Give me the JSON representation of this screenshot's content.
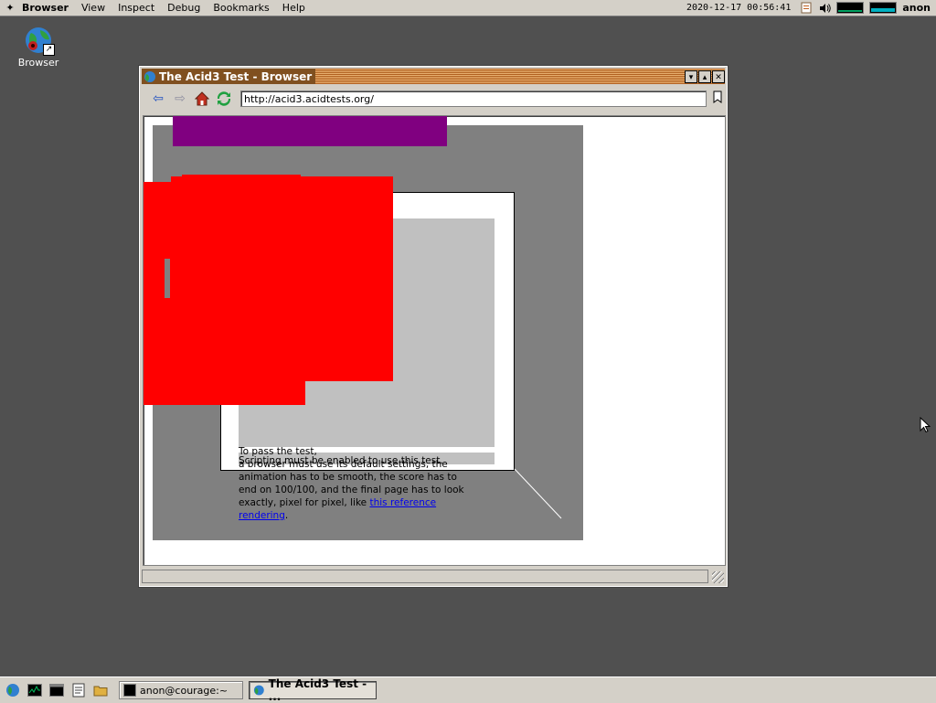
{
  "menubar": {
    "app_name": "Browser",
    "items": [
      "View",
      "Inspect",
      "Debug",
      "Bookmarks",
      "Help"
    ],
    "clock": "2020-12-17 00:56:41",
    "user": "anon"
  },
  "desktop": {
    "icon_label": "Browser"
  },
  "window": {
    "title": "The Acid3 Test - Browser",
    "url": "http://acid3.acidtests.org/",
    "content": {
      "line1": "To pass the test,",
      "line2_overlap": "Scripting must be enabled to use this test.",
      "para": "a browser must use its default settings, the animation has to be smooth, the score has to end on 100/100, and the final page has to look exactly, pixel for pixel, like",
      "link_text": "this reference rendering",
      "trailing": "."
    }
  },
  "taskbar": {
    "tasks": [
      {
        "label": "anon@courage:~"
      },
      {
        "label": "The Acid3 Test - ..."
      }
    ]
  },
  "colors": {
    "desktop": "#505050",
    "chrome": "#d4d0c8",
    "acid_gray": "#808080",
    "acid_light": "#c0c0c0",
    "acid_red": "#ff0000",
    "acid_purple": "#800080",
    "link": "#0000ee"
  }
}
